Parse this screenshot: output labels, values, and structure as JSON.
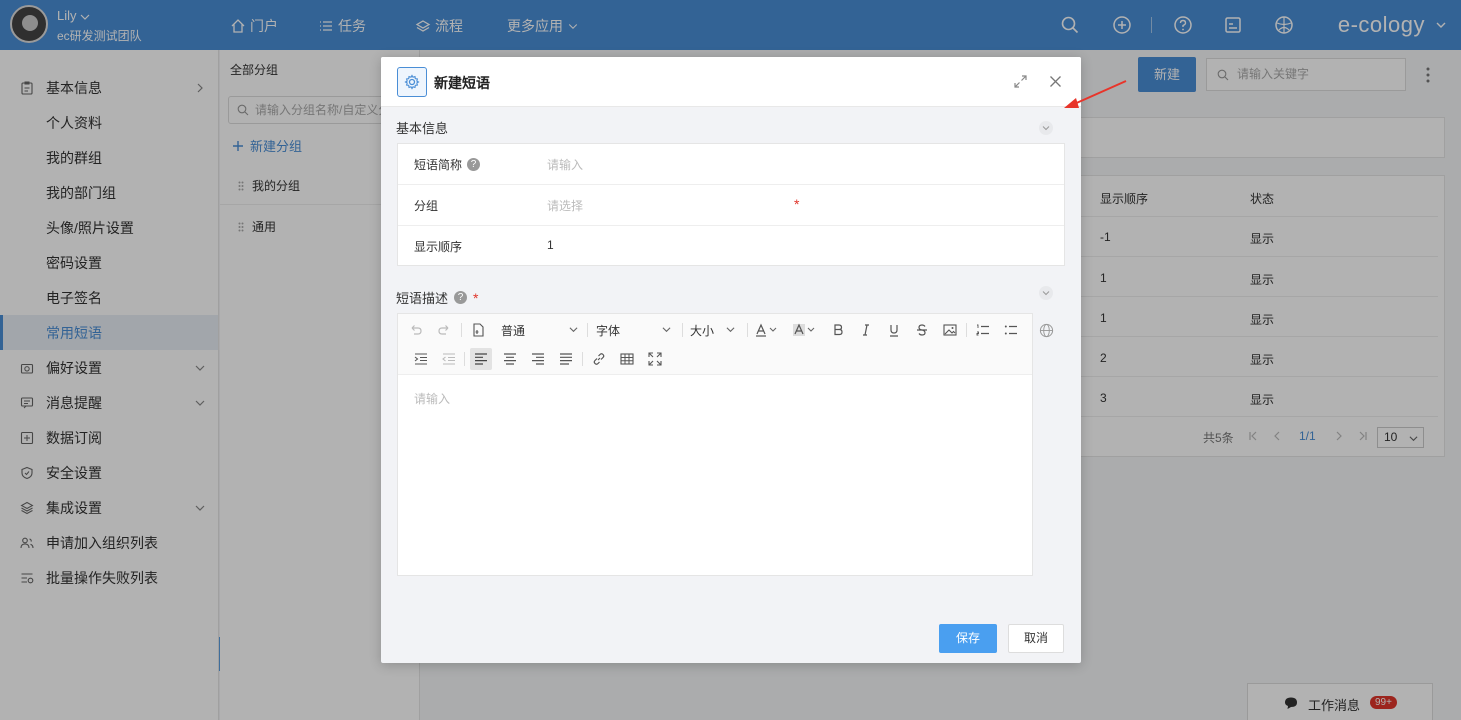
{
  "header": {
    "user_name": "Lily",
    "user_team": "ec研发测试团队",
    "nav": [
      {
        "label": "门户"
      },
      {
        "label": "任务"
      },
      {
        "label": "流程"
      },
      {
        "label": "更多应用"
      }
    ],
    "brand": "e-cology"
  },
  "sidebar": {
    "items": [
      {
        "label": "基本信息"
      },
      {
        "label": "个人资料"
      },
      {
        "label": "我的群组"
      },
      {
        "label": "我的部门组"
      },
      {
        "label": "头像/照片设置"
      },
      {
        "label": "密码设置"
      },
      {
        "label": "电子签名"
      },
      {
        "label": "常用短语"
      },
      {
        "label": "偏好设置"
      },
      {
        "label": "消息提醒"
      },
      {
        "label": "数据订阅"
      },
      {
        "label": "安全设置"
      },
      {
        "label": "集成设置"
      },
      {
        "label": "申请加入组织列表"
      },
      {
        "label": "批量操作失败列表"
      }
    ]
  },
  "groups_panel": {
    "title": "全部分组",
    "search_placeholder": "请输入分组名称/自定义分",
    "new_group": "新建分组",
    "groups": [
      {
        "label": "我的分组"
      },
      {
        "label": "通用"
      }
    ]
  },
  "list_view": {
    "new_button": "新建",
    "search_placeholder": "请输入关键字",
    "columns": [
      "显示顺序",
      "状态"
    ],
    "rows": [
      {
        "order": "-1",
        "status": "显示"
      },
      {
        "order": "1",
        "status": "显示"
      },
      {
        "order": "1",
        "status": "显示"
      },
      {
        "order": "2",
        "status": "显示"
      },
      {
        "order": "3",
        "status": "显示"
      }
    ],
    "pager": {
      "total": "共5条",
      "page": "1/1",
      "size": "10"
    }
  },
  "work_message": {
    "label": "工作消息",
    "badge": "99+"
  },
  "modal": {
    "title": "新建短语",
    "basic_section": "基本信息",
    "fields": [
      {
        "label": "短语简称",
        "value": "请输入"
      },
      {
        "label": "分组",
        "value": "请选择",
        "required_mark": "*"
      },
      {
        "label": "显示顺序",
        "value": "1"
      }
    ],
    "desc_section": "短语描述",
    "desc_required": "*",
    "toolbar": {
      "format": "普通",
      "font": "字体",
      "size": "大小"
    },
    "editor_placeholder": "请输入",
    "save": "保存",
    "cancel": "取消"
  },
  "colors": {
    "header_bg": "#4a8ed6",
    "primary": "#4a9ff0",
    "required": "#e0352b",
    "annotation_arrow": "#e8342a"
  }
}
